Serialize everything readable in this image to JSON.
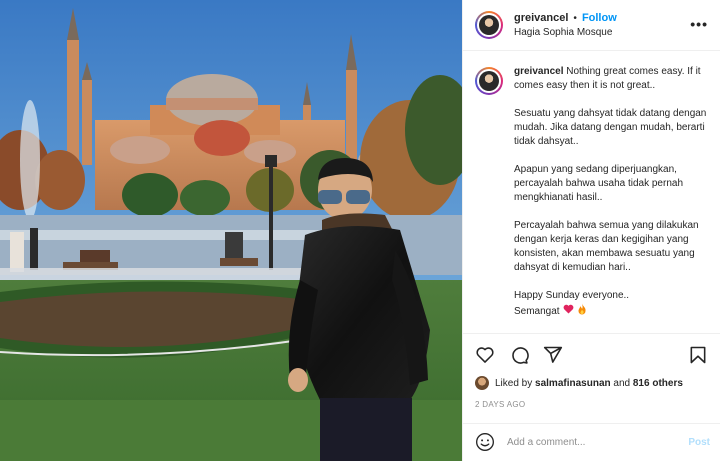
{
  "post": {
    "username": "greivancel",
    "separator": "•",
    "follow_label": "Follow",
    "location": "Hagia Sophia Mosque",
    "more_label": "•••",
    "image_alt": "Man in black leather jacket and sunglasses in front of Hagia Sophia"
  },
  "caption": {
    "username": "greivancel",
    "first_line": "Nothing great comes easy. If it comes easy then it is not great..",
    "paragraphs": [
      "Sesuatu yang dahsyat tidak datang dengan mudah. Jika datang dengan mudah, berarti tidak dahsyat..",
      "Apapun yang sedang diperjuangkan, percayalah bahwa usaha tidak pernah mengkhianati hasil..",
      "Percayalah bahwa semua yang dilakukan dengan kerja keras dan kegigihan yang konsisten, akan membawa sesuatu yang dahsyat di kemudian hari..",
      "Happy Sunday everyone..",
      "Semangat"
    ]
  },
  "likes": {
    "prefix": "Liked by",
    "user": "salmafinasunan",
    "and": "and",
    "count": "816 others"
  },
  "timestamp": "2 DAYS AGO",
  "comment": {
    "placeholder": "Add a comment...",
    "post_label": "Post"
  },
  "colors": {
    "follow": "#0095f6",
    "post_disabled": "#b2dffc",
    "muted": "#8e8e8e",
    "text": "#262626"
  },
  "icons": [
    "heart-icon",
    "comment-icon",
    "share-icon",
    "bookmark-icon",
    "smile-icon",
    "more-icon"
  ]
}
